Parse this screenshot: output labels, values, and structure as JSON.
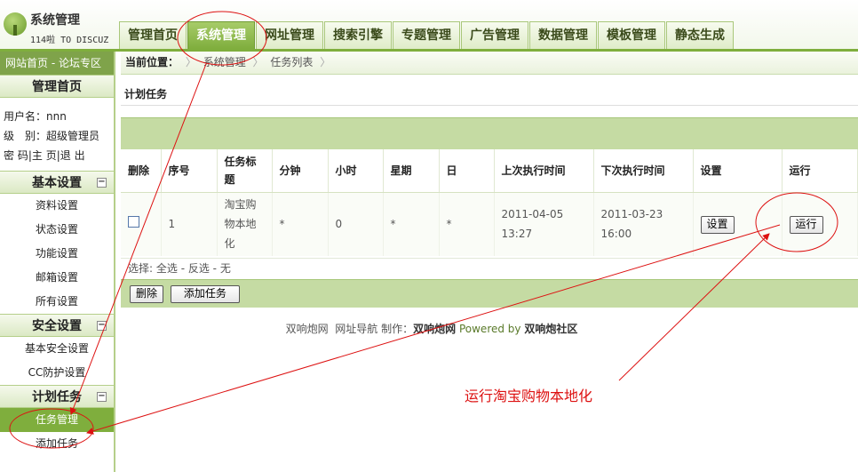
{
  "logo": {
    "title": "系统管理",
    "subtitle": "114啦 TO DISCUZ"
  },
  "nav": {
    "tabs": [
      {
        "label": "管理首页"
      },
      {
        "label": "系统管理"
      },
      {
        "label": "网址管理"
      },
      {
        "label": "搜索引擎"
      },
      {
        "label": "专题管理"
      },
      {
        "label": "广告管理"
      },
      {
        "label": "数据管理"
      },
      {
        "label": "模板管理"
      },
      {
        "label": "静态生成"
      }
    ],
    "active_index": 1
  },
  "sidebar": {
    "top_links": {
      "home": "网站首页",
      "sep": " - ",
      "forum": "论坛专区"
    },
    "admin_home": "管理首页",
    "user": {
      "username_label": "用户名：",
      "username": "nnn",
      "level_label": "级　别：",
      "level": "超级管理员",
      "links": {
        "password": "密 码",
        "home": "主 页",
        "logout": "退 出"
      }
    },
    "sections": [
      {
        "title": "基本设置",
        "toggle": "−",
        "items": [
          "资料设置",
          "状态设置",
          "功能设置",
          "邮箱设置",
          "所有设置"
        ]
      },
      {
        "title": "安全设置",
        "toggle": "−",
        "items": [
          "基本安全设置",
          "CC防护设置"
        ]
      },
      {
        "title": "计划任务",
        "toggle": "−",
        "items": [
          "任务管理",
          "添加任务"
        ]
      }
    ]
  },
  "breadcrumb": {
    "label": "当前位置：",
    "items": [
      "系统管理",
      "任务列表"
    ]
  },
  "page_title": "计划任务",
  "table": {
    "headers": [
      "删除",
      "序号",
      "任务标题",
      "分钟",
      "小时",
      "星期",
      "日",
      "上次执行时间",
      "下次执行时间",
      "设置",
      "运行"
    ],
    "rows": [
      {
        "id": "1",
        "title": "淘宝购物本地化",
        "minute": "*",
        "hour": "0",
        "weekday": "*",
        "day": "*",
        "last_run": "2011-04-05 13:27",
        "next_run": "2011-03-23 16:00",
        "settings_label": "设置",
        "run_label": "运行"
      }
    ]
  },
  "selection": {
    "label": "选择: ",
    "all": "全选",
    "invert": "反选",
    "none": "无",
    "sep": " - "
  },
  "actions": {
    "delete_label": "删除",
    "add_label": "添加任务"
  },
  "footer": {
    "site": "双响炮网",
    "nav": "网址导航",
    "made_label": "制作：",
    "maker": "双响炮网",
    "powered": "Powered by",
    "community": "双响炮社区"
  },
  "annotation": {
    "text": "运行淘宝购物本地化",
    "color": "#dd1111"
  }
}
